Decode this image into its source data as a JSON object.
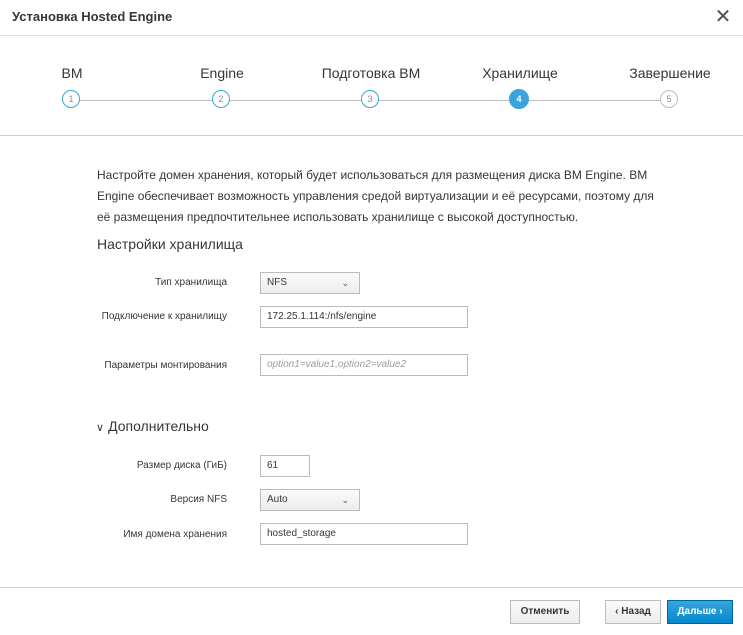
{
  "dialog": {
    "title": "Установка Hosted Engine",
    "close_symbol": "✕"
  },
  "steps": [
    {
      "label": "ВМ",
      "number": "1"
    },
    {
      "label": "Engine",
      "number": "2"
    },
    {
      "label": "Подготовка ВМ",
      "number": "3"
    },
    {
      "label": "Хранилище",
      "number": "4"
    },
    {
      "label": "Завершение",
      "number": "5"
    }
  ],
  "active_step": 4,
  "intro_text": "Настройте домен хранения, который будет использоваться для размещения диска ВМ Engine. ВМ Engine обеспечивает возможность управления средой виртуализации и её ресурсами, поэтому для её размещения предпочтительнее использовать хранилище с высокой доступностью.",
  "storage": {
    "section_title": "Настройки хранилища",
    "type_label": "Тип хранилища",
    "type_value": "NFS",
    "connection_label": "Подключение к хранилищу",
    "connection_value": "172.25.1.114:/nfs/engine",
    "mount_label": "Параметры монтирования",
    "mount_placeholder": "option1=value1,option2=value2"
  },
  "advanced": {
    "title": "Дополнительно",
    "disk_size_label": "Размер диска (ГиБ)",
    "disk_size_value": "61",
    "nfs_version_label": "Версия NFS",
    "nfs_version_value": "Auto",
    "domain_name_label": "Имя домена хранения",
    "domain_name_value": "hosted_storage"
  },
  "footer": {
    "cancel_label": "Отменить",
    "back_label": "‹ Назад",
    "next_label": "Дальше ›"
  },
  "colors": {
    "accent": "#39a5dc",
    "primary_button": "#0088ce"
  }
}
